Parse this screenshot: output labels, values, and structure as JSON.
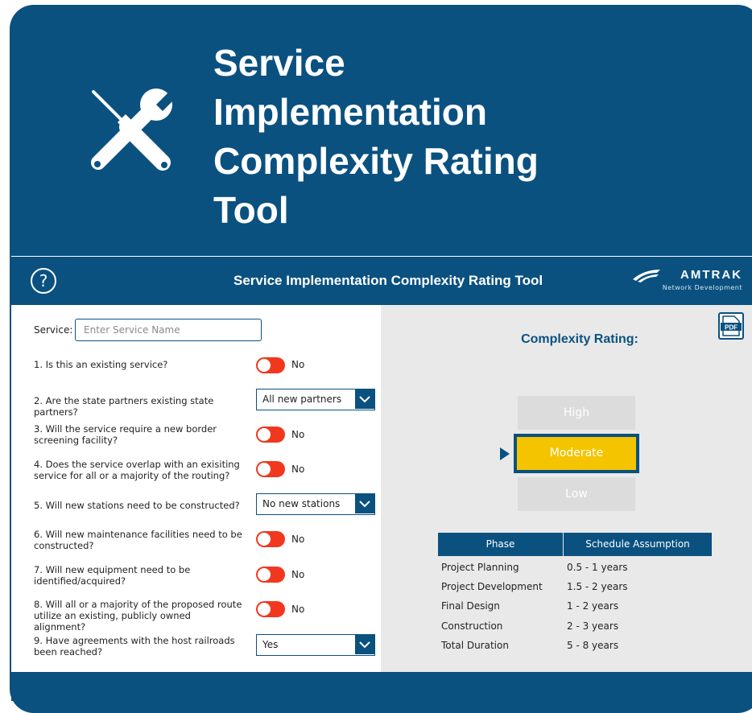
{
  "hero": {
    "title": "Service Implementation Complexity Rating Tool",
    "icon": "tools-icon"
  },
  "header": {
    "help_label": "?",
    "title": "Service Implementation Complexity Rating Tool",
    "brand_name": "AMTRAK",
    "brand_sub": "Network Development"
  },
  "form": {
    "service_label": "Service:",
    "service_placeholder": "Enter Service Name",
    "questions": [
      {
        "text": "1. Is this an existing service?",
        "control": "toggle",
        "value": "No"
      },
      {
        "text": "2. Are the state partners existing state partners?",
        "control": "dropdown",
        "value": "All new partners"
      },
      {
        "text": "3. Will the service require a new border screening facility?",
        "control": "toggle",
        "value": "No"
      },
      {
        "text": "4. Does the service overlap with an exisiting service for all or a majority of the routing?",
        "control": "toggle",
        "value": "No"
      },
      {
        "text": "5. Will new stations need to be constructed?",
        "control": "dropdown",
        "value": "No new stations"
      },
      {
        "text": "6. Will new maintenance facilities need to be constructed?",
        "control": "toggle",
        "value": "No"
      },
      {
        "text": "7. Will new equipment need to be identified/acquired?",
        "control": "toggle",
        "value": "No"
      },
      {
        "text": "8. Will all or a majority of the proposed route utilize an existing, publicly owned alignment?",
        "control": "toggle",
        "value": "No"
      },
      {
        "text": "9. Have agreements with the host railroads been reached?",
        "control": "dropdown",
        "value": "Yes"
      }
    ]
  },
  "rating": {
    "title": "Complexity Rating:",
    "levels": [
      "High",
      "Moderate",
      "Low"
    ],
    "selected": "Moderate"
  },
  "schedule": {
    "headers": [
      "Phase",
      "Schedule Assumption"
    ],
    "rows": [
      {
        "phase": "Project Planning",
        "value": "0.5 - 1 years"
      },
      {
        "phase": "Project Development",
        "value": "1.5 - 2 years"
      },
      {
        "phase": "Final Design",
        "value": "1 - 2 years"
      },
      {
        "phase": "Construction",
        "value": "2 - 3 years"
      },
      {
        "phase": "Total Duration",
        "value": "5 - 8 years"
      }
    ]
  },
  "colors": {
    "brand_blue": "#0a5180",
    "toggle_off": "#f1381f",
    "selected_rating": "#f5c400",
    "inactive_rating": "#dcdcdc"
  }
}
